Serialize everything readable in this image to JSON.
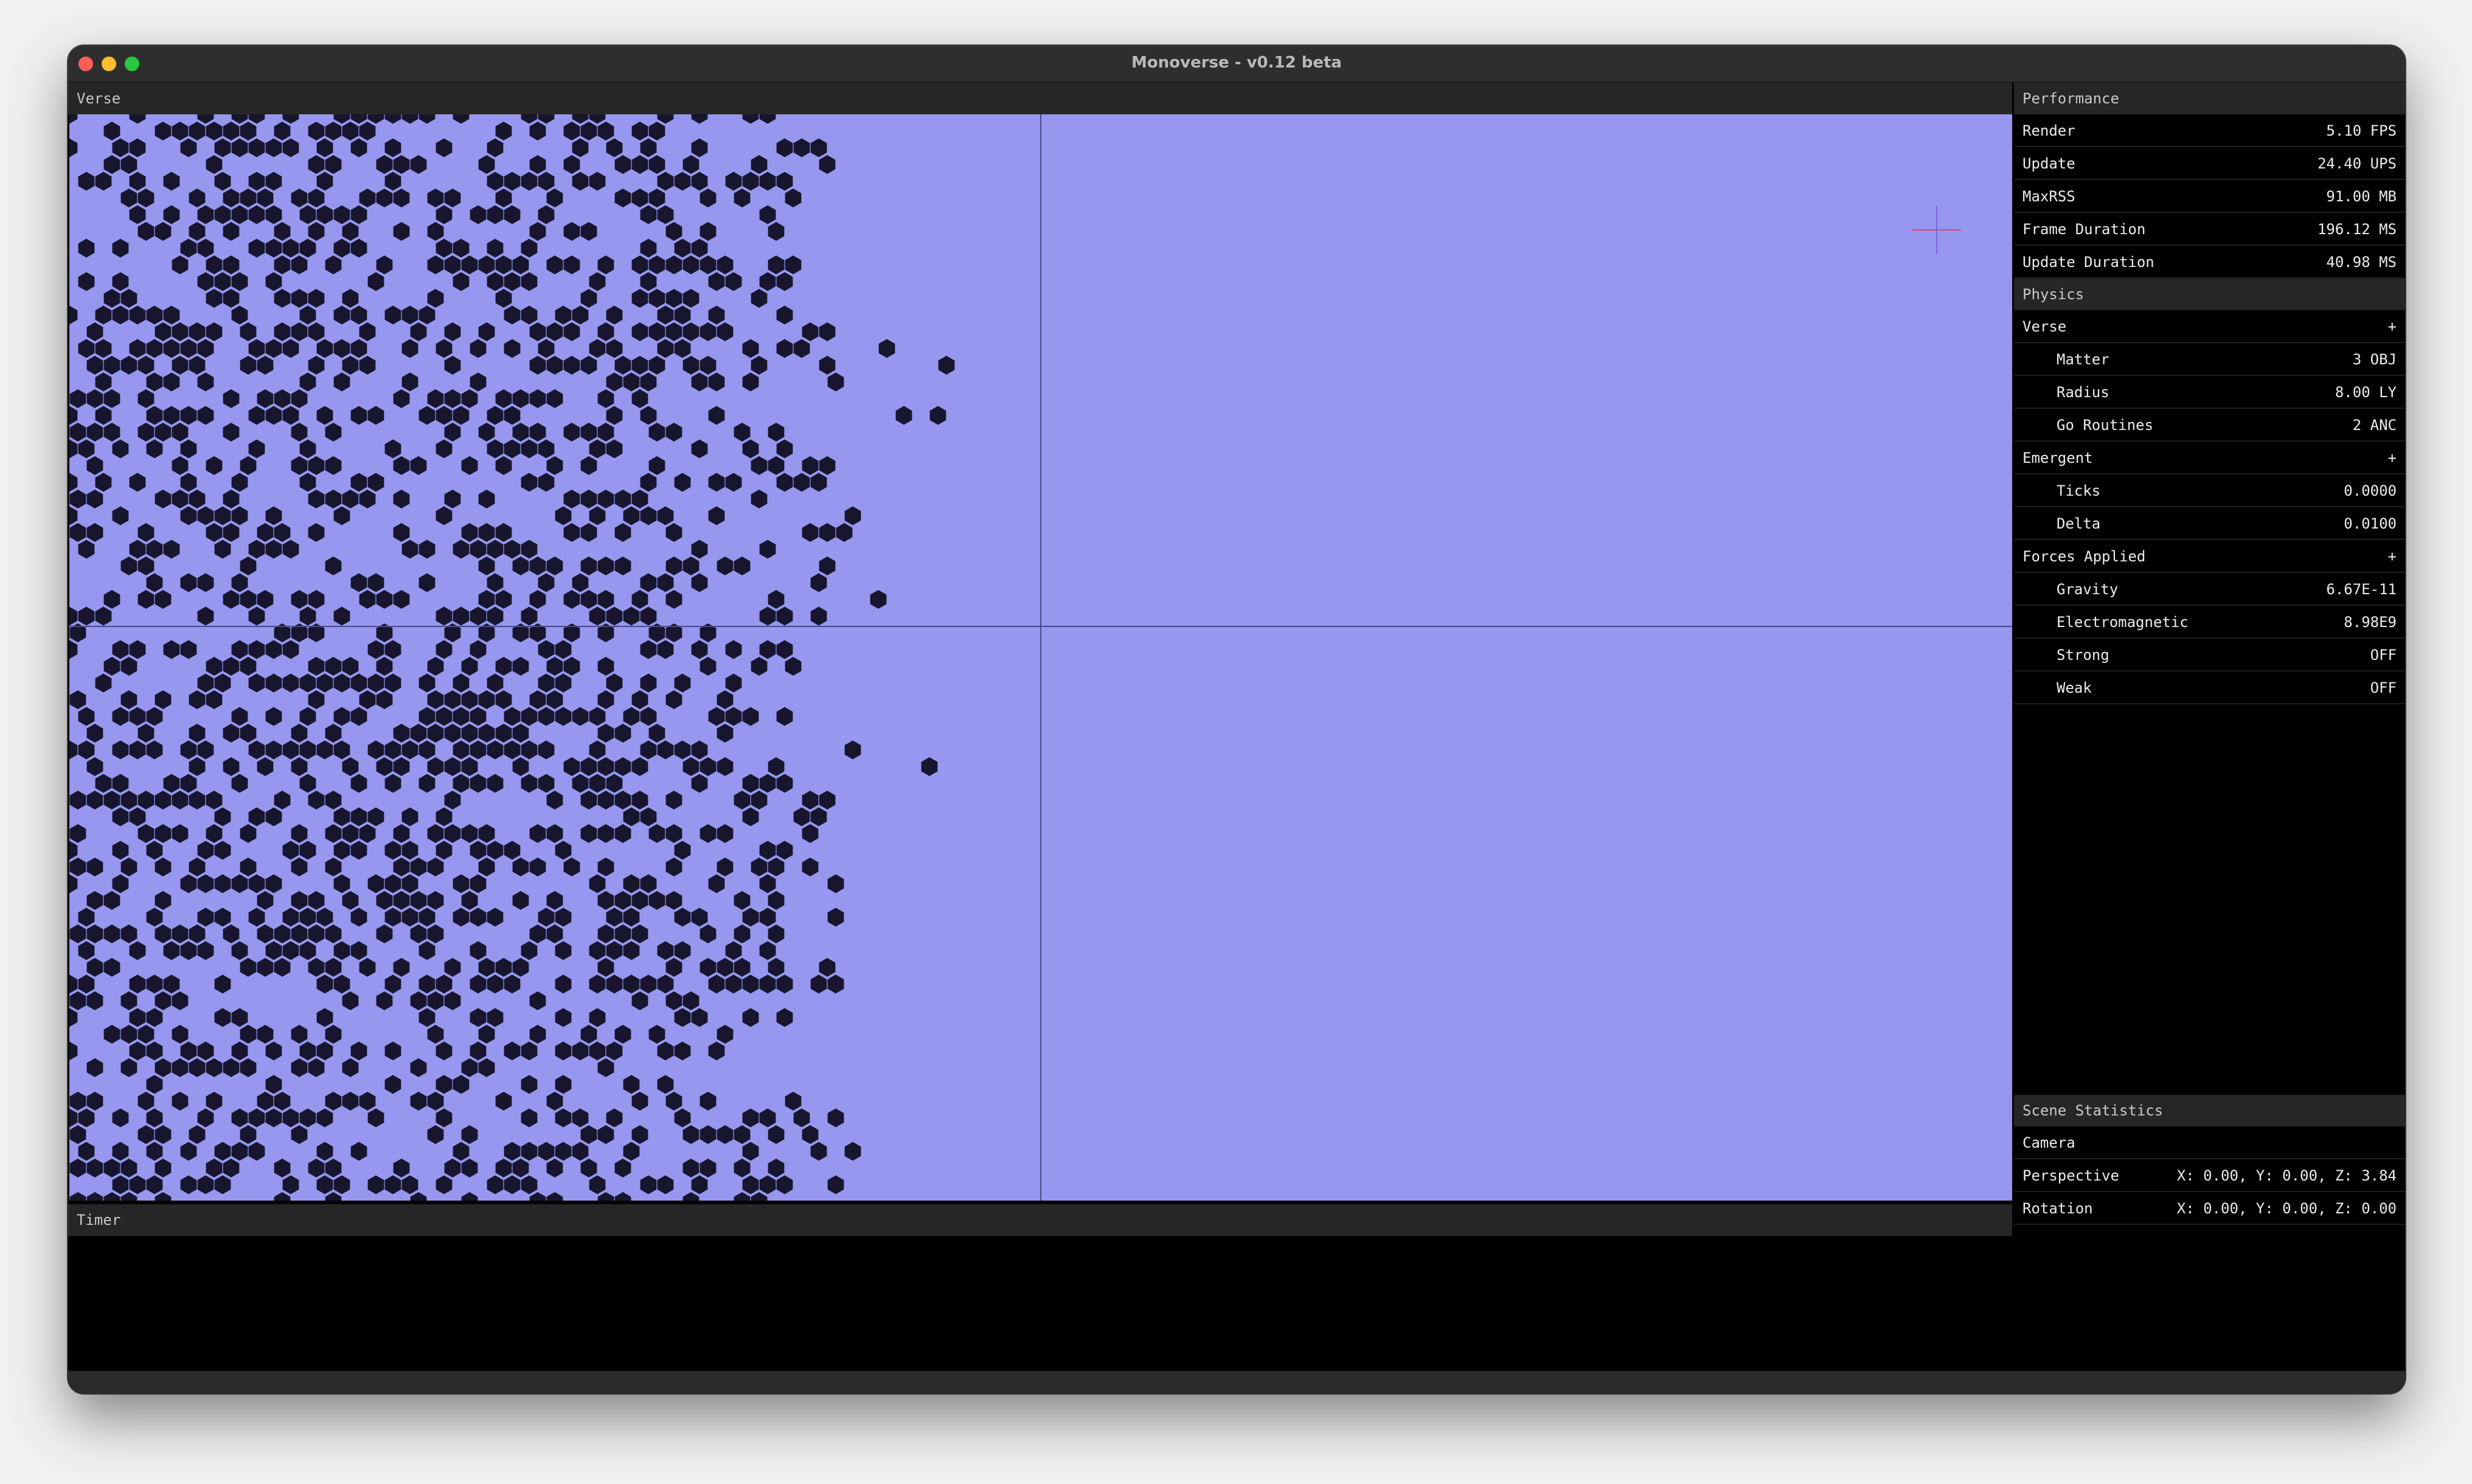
{
  "window": {
    "title": "Monoverse - v0.12 beta"
  },
  "panels": {
    "verse": "Verse",
    "timer": "Timer"
  },
  "performance": {
    "title": "Performance",
    "rows": [
      {
        "label": "Render",
        "value": "5.10 FPS"
      },
      {
        "label": "Update",
        "value": "24.40 UPS"
      },
      {
        "label": "MaxRSS",
        "value": "91.00 MB"
      },
      {
        "label": "Frame Duration",
        "value": "196.12 MS"
      },
      {
        "label": "Update Duration",
        "value": "40.98 MS"
      }
    ]
  },
  "physics": {
    "title": "Physics",
    "verse": {
      "label": "Verse",
      "toggle": "+"
    },
    "matter": {
      "label": "Matter",
      "value": "3 OBJ"
    },
    "radius": {
      "label": "Radius",
      "value": "8.00 LY"
    },
    "go_routines": {
      "label": "Go Routines",
      "value": "2 ANC"
    },
    "emergent": {
      "label": "Emergent",
      "toggle": "+"
    },
    "ticks": {
      "label": "Ticks",
      "value": "0.0000"
    },
    "delta": {
      "label": "Delta",
      "value": "0.0100"
    },
    "forces": {
      "label": "Forces Applied",
      "toggle": "+"
    },
    "gravity": {
      "label": "Gravity",
      "value": "6.67E-11"
    },
    "electromagnetic": {
      "label": "Electromagnetic",
      "value": "8.98E9"
    },
    "strong": {
      "label": "Strong",
      "value": "OFF"
    },
    "weak": {
      "label": "Weak",
      "value": "OFF"
    }
  },
  "scene": {
    "title": "Scene Statistics",
    "camera": {
      "label": "Camera"
    },
    "perspective": {
      "label": "Perspective",
      "value": "X: 0.00, Y: 0.00, Z: 3.84"
    },
    "rotation": {
      "label": "Rotation",
      "value": "X: 0.00, Y: 0.00, Z: 0.00"
    }
  },
  "colors": {
    "viewport": "#9797ef",
    "cells": "#17162e",
    "axis_lines": "#4a4a86"
  }
}
